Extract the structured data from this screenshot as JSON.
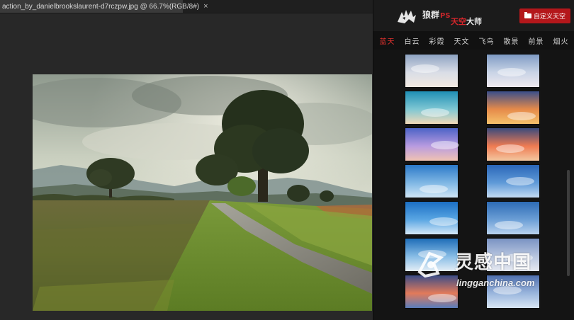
{
  "document": {
    "tab_title": "action_by_danielbrookslaurent-d7rczpw.jpg @ 66.7%(RGB/8#)",
    "close_glyph": "×"
  },
  "panel": {
    "brand": {
      "name": "狼群",
      "ps": "PS",
      "sub_red": "天空",
      "sub_white": "大师"
    },
    "custom_button_label": "自定义天空",
    "categories": [
      "蓝天",
      "白云",
      "彩霞",
      "天文",
      "飞鸟",
      "散景",
      "前景",
      "烟火"
    ],
    "active_category": "蓝天",
    "thumbnails": [
      {
        "name": "sky-1",
        "colors": [
          "#8ea3c2",
          "#d9dde6",
          "#f2e9e2"
        ]
      },
      {
        "name": "sky-2",
        "colors": [
          "#7f9bc4",
          "#c9d4e6",
          "#efe9ef"
        ]
      },
      {
        "name": "sky-3",
        "colors": [
          "#1f8fb5",
          "#7fc7d3",
          "#f1d9b8"
        ]
      },
      {
        "name": "sky-4",
        "colors": [
          "#3b4f8a",
          "#e58a4a",
          "#f6c26b"
        ]
      },
      {
        "name": "sky-5",
        "colors": [
          "#4c63c6",
          "#b89be0",
          "#f1c3b2"
        ]
      },
      {
        "name": "sky-6",
        "colors": [
          "#3a4a7c",
          "#ef7b52",
          "#f3c7a0"
        ]
      },
      {
        "name": "sky-7",
        "colors": [
          "#2c79c8",
          "#7fb7e4",
          "#cfe6f6"
        ]
      },
      {
        "name": "sky-8",
        "colors": [
          "#2a66b8",
          "#5f9ad8",
          "#c4dbf2"
        ]
      },
      {
        "name": "sky-9",
        "colors": [
          "#1b6fc4",
          "#5aa6e3",
          "#d5e8f7"
        ]
      },
      {
        "name": "sky-10",
        "colors": [
          "#2d6bb5",
          "#6c9fd6",
          "#b9d2ee"
        ]
      },
      {
        "name": "sky-11",
        "colors": [
          "#1e6db8",
          "#88bde6",
          "#e4eef6"
        ]
      },
      {
        "name": "sky-12",
        "colors": [
          "#7a93c3",
          "#b8c6df",
          "#e6e9f1"
        ]
      },
      {
        "name": "sky-13",
        "colors": [
          "#3b4d87",
          "#e27a5a",
          "#5a7dbb"
        ]
      },
      {
        "name": "sky-14",
        "colors": [
          "#4f6fae",
          "#9ab6dd",
          "#d8e5f3"
        ]
      }
    ]
  },
  "watermark": {
    "title": "灵感中国",
    "url": "lingganchina.com"
  },
  "colors": {
    "accent_red": "#b4171b",
    "active_tab": "#e5322f",
    "panel_bg": "#141414",
    "canvas_bg": "#282828"
  }
}
